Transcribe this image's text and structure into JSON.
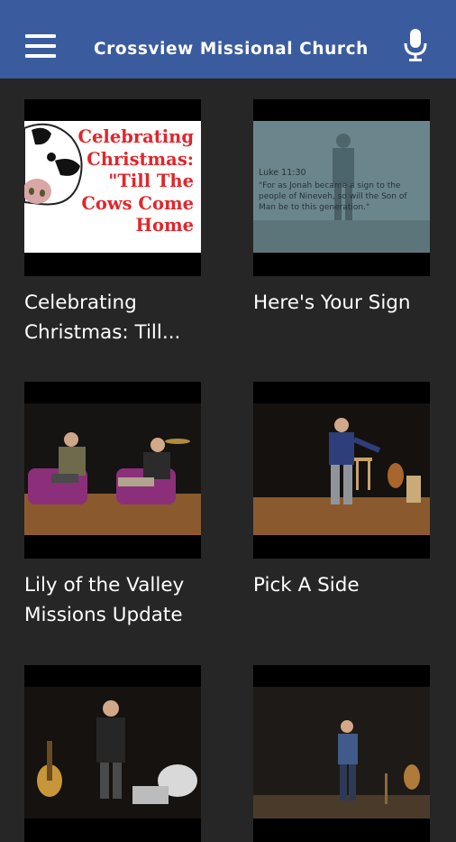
{
  "app": {
    "title": "Crossview Missional Church",
    "theme_color": "#3a5c9e",
    "menu_icon": "hamburger-menu-icon",
    "mic_icon": "microphone-icon"
  },
  "videos": [
    {
      "title": "Celebrating Christmas: Till...",
      "thumbnail_caption": "Celebrating\nChristmas:\n\"Till The\nCows Come\nHome"
    },
    {
      "title": "Here's Your Sign",
      "thumbnail_verse_ref": "Luke 11:30",
      "thumbnail_verse_text": "\"For as Jonah became a sign to the people of Nineveh, so will the Son of Man be to this generation.\""
    },
    {
      "title": "Lily of the Valley Missions Update"
    },
    {
      "title": "Pick A Side"
    },
    {
      "title": ""
    },
    {
      "title": ""
    }
  ]
}
